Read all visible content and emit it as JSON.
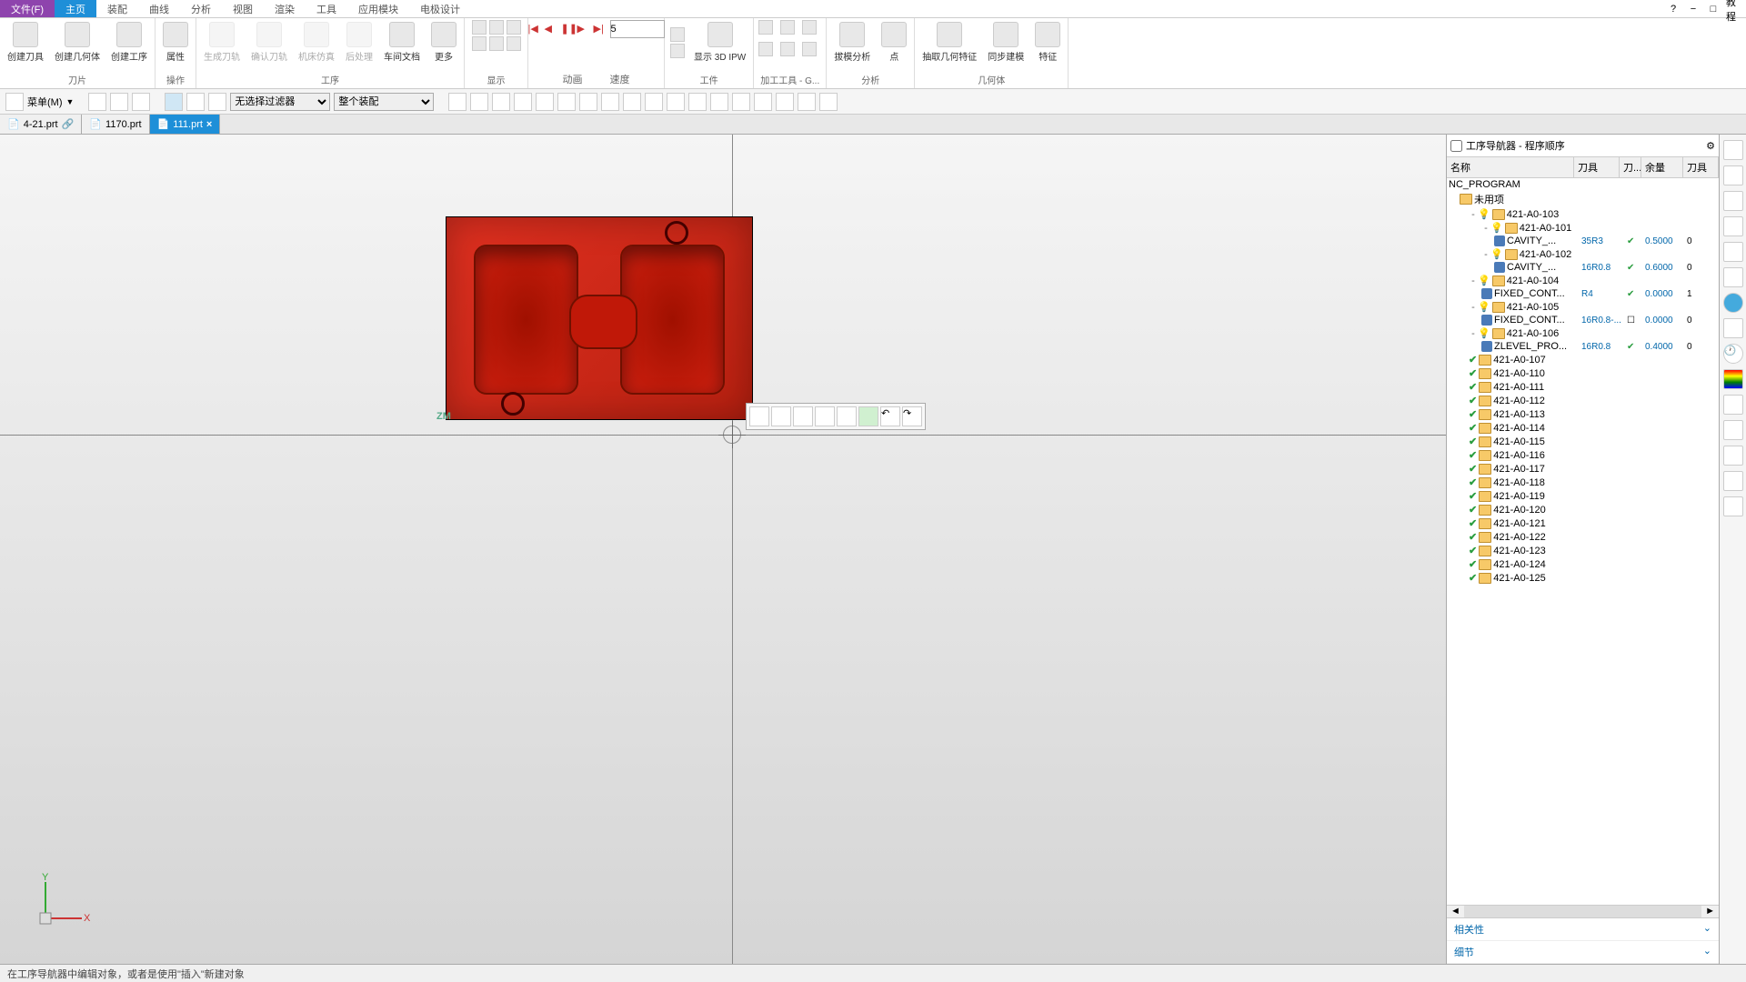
{
  "mainTabs": {
    "file": "文件(F)",
    "home": "主页",
    "assembly": "装配",
    "curve": "曲线",
    "analysis": "分析",
    "view": "视图",
    "render": "渲染",
    "tool": "工具",
    "app": "应用模块",
    "electrode": "电极设计"
  },
  "ribbon": {
    "group1": {
      "btn1": "创建刀具",
      "btn2": "创建几何体",
      "btn3": "创建工序",
      "label": "刀片"
    },
    "group2": {
      "btn1": "属性",
      "label": "操作"
    },
    "group3": {
      "btn1": "生成刀轨",
      "btn2": "确认刀轨",
      "btn3": "机床仿真",
      "btn4": "后处理",
      "btn5": "车间文档",
      "btn6": "更多",
      "label": "工序"
    },
    "group4": {
      "label": "显示"
    },
    "group5": {
      "label": "动画",
      "speed_label": "速度",
      "speed_value": "5"
    },
    "group6": {
      "btn1": "显示 3D IPW",
      "label": "工件"
    },
    "group7": {
      "label": "加工工具 - G..."
    },
    "group8": {
      "btn1": "拔模分析",
      "btn2": "点",
      "label": "分析"
    },
    "group9": {
      "btn1": "抽取几何特征",
      "btn2": "同步建模",
      "btn3": "特征",
      "label": "几何体"
    }
  },
  "toolbar": {
    "menu": "菜单(M)",
    "filter": "无选择过滤器",
    "assembly": "整个装配"
  },
  "docTabs": {
    "t1": "4-21.prt",
    "t2": "1170.prt",
    "t3": "111.prt"
  },
  "axis": {
    "x": "X",
    "y": "Y",
    "z": "ZM"
  },
  "nav": {
    "title": "工序导航器 - 程序顺序",
    "cols": {
      "name": "名称",
      "tool": "刀具",
      "t2": "刀...",
      "remain": "余量",
      "t3": "刀具"
    },
    "root": "NC_PROGRAM",
    "unused": "未用项",
    "items": [
      {
        "name": "421-A0-103",
        "depth": 1,
        "exp": "-",
        "bulb": true
      },
      {
        "name": "421-A0-101",
        "depth": 2,
        "exp": "-",
        "bulb": true
      },
      {
        "name": "CAVITY_...",
        "depth": 3,
        "op": true,
        "tool": "35R3",
        "check": true,
        "remain": "0.5000",
        "extra": "0"
      },
      {
        "name": "421-A0-102",
        "depth": 2,
        "exp": "-",
        "bulb": true
      },
      {
        "name": "CAVITY_...",
        "depth": 3,
        "op": true,
        "tool": "16R0.8",
        "check": true,
        "remain": "0.6000",
        "extra": "0"
      },
      {
        "name": "421-A0-104",
        "depth": 1,
        "exp": "-",
        "bulb": true
      },
      {
        "name": "FIXED_CONT...",
        "depth": 2,
        "op": true,
        "tool": "R4",
        "check": true,
        "remain": "0.0000",
        "extra": "1"
      },
      {
        "name": "421-A0-105",
        "depth": 1,
        "exp": "-",
        "bulb": true
      },
      {
        "name": "FIXED_CONT...",
        "depth": 2,
        "op": true,
        "tool": "16R0.8-...",
        "box": true,
        "remain": "0.0000",
        "extra": "0"
      },
      {
        "name": "421-A0-106",
        "depth": 1,
        "exp": "-",
        "bulb": true
      },
      {
        "name": "ZLEVEL_PRO...",
        "depth": 2,
        "op": true,
        "tool": "16R0.8",
        "check": true,
        "remain": "0.4000",
        "extra": "0"
      },
      {
        "name": "421-A0-107",
        "depth": 1,
        "chk": true
      },
      {
        "name": "421-A0-110",
        "depth": 1,
        "chk": true
      },
      {
        "name": "421-A0-111",
        "depth": 1,
        "chk": true
      },
      {
        "name": "421-A0-112",
        "depth": 1,
        "chk": true
      },
      {
        "name": "421-A0-113",
        "depth": 1,
        "chk": true
      },
      {
        "name": "421-A0-114",
        "depth": 1,
        "chk": true
      },
      {
        "name": "421-A0-115",
        "depth": 1,
        "chk": true
      },
      {
        "name": "421-A0-116",
        "depth": 1,
        "chk": true
      },
      {
        "name": "421-A0-117",
        "depth": 1,
        "chk": true
      },
      {
        "name": "421-A0-118",
        "depth": 1,
        "chk": true
      },
      {
        "name": "421-A0-119",
        "depth": 1,
        "chk": true
      },
      {
        "name": "421-A0-120",
        "depth": 1,
        "chk": true
      },
      {
        "name": "421-A0-121",
        "depth": 1,
        "chk": true
      },
      {
        "name": "421-A0-122",
        "depth": 1,
        "chk": true
      },
      {
        "name": "421-A0-123",
        "depth": 1,
        "chk": true
      },
      {
        "name": "421-A0-124",
        "depth": 1,
        "chk": true
      },
      {
        "name": "421-A0-125",
        "depth": 1,
        "chk": true
      }
    ],
    "related": "相关性",
    "detail": "细节"
  },
  "status": "在工序导航器中编辑对象，或者是使用\"插入\"新建对象",
  "tutorialBtn": "教程"
}
